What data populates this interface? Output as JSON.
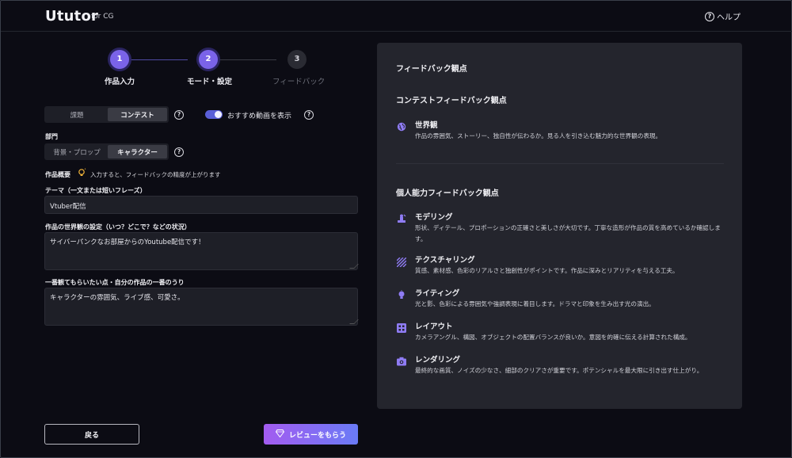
{
  "header": {
    "logo": "Ututor",
    "logo_sub": "for CG",
    "help_label": "ヘルプ"
  },
  "stepper": {
    "steps": [
      {
        "number": "1",
        "label": "作品入力",
        "state": "done"
      },
      {
        "number": "2",
        "label": "モード・設定",
        "state": "current"
      },
      {
        "number": "3",
        "label": "フィードバック",
        "state": "upcoming"
      }
    ]
  },
  "mode": {
    "options": [
      "課題",
      "コンテスト"
    ],
    "selected": "コンテスト"
  },
  "recommend_toggle": {
    "label": "おすすめ動画を表示",
    "on": true
  },
  "category": {
    "label": "部門",
    "options": [
      "背景・プロップ",
      "キャラクター"
    ],
    "selected": "キャラクター"
  },
  "overview": {
    "label": "作品概要",
    "hint": "入力すると、フィードバックの精度が上がります"
  },
  "fields": {
    "theme": {
      "label": "テーマ（一文または短いフレーズ）",
      "value": "Vtuber配信"
    },
    "world": {
      "label": "作品の世界観の設定（いつ？どこで？などの状況）",
      "value": "サイバーパンクなお部屋からのYoutube配信です！"
    },
    "appeal": {
      "label": "一番観てもらいたい点・自分の作品の一番のうり",
      "value": "キャラクターの雰囲気、ライブ感、可愛さ。"
    }
  },
  "buttons": {
    "back": "戻る",
    "review": "レビューをもらう"
  },
  "panel": {
    "title": "フィードバック観点",
    "contest_title": "コンテストフィードバック観点",
    "contest_items": [
      {
        "icon": "globe-icon",
        "title": "世界観",
        "desc": "作品の雰囲気、ストーリー、独自性が伝わるか。見る人を引き込む魅力的な世界観の表現。"
      }
    ],
    "skills_title": "個人能力フィードバック観点",
    "skills_items": [
      {
        "icon": "sculpt-icon",
        "title": "モデリング",
        "desc": "形状、ディテール、プロポーションの正確さと美しさが大切です。丁寧な造形が作品の質を高めているか確認します。"
      },
      {
        "icon": "texture-icon",
        "title": "テクスチャリング",
        "desc": "質感、素材感、色彩のリアルさと独創性がポイントです。作品に深みとリアリティを与える工夫。"
      },
      {
        "icon": "light-icon",
        "title": "ライティング",
        "desc": "光と影、色彩による雰囲気や強調表現に着目します。ドラマと印象を生み出す光の演出。"
      },
      {
        "icon": "layout-icon",
        "title": "レイアウト",
        "desc": "カメラアングル、構図、オブジェクトの配置バランスが良いか。意図を的確に伝える計算された構成。"
      },
      {
        "icon": "camera-icon",
        "title": "レンダリング",
        "desc": "最終的な画質、ノイズの少なさ、細部のクリアさが重要です。ポテンシャルを最大限に引き出す仕上がり。"
      }
    ]
  },
  "colors": {
    "accent": "#7a63e9",
    "icon": "#8f7cf4",
    "background": "#0c0c14",
    "panel": "#24252d"
  }
}
